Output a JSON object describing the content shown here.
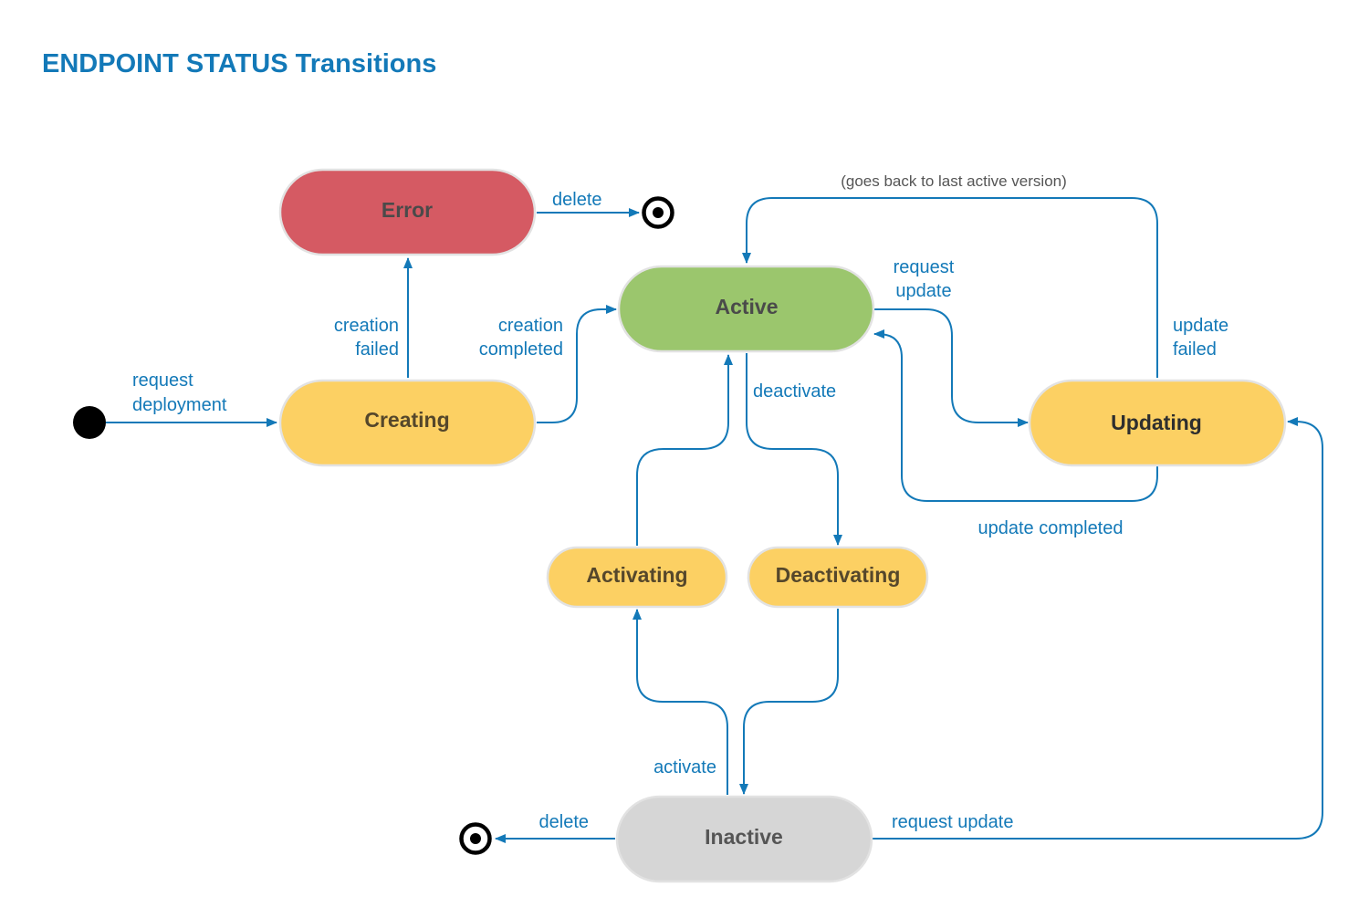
{
  "title": "ENDPOINT STATUS Transitions",
  "colors": {
    "accent": "#1379b8",
    "error_fill": "#d55a63",
    "active_fill": "#9bc66d",
    "transitional_fill": "#fcd063",
    "inactive_fill": "#d6d6d6",
    "node_text": "#4a4a4a",
    "pseudo_state": "#000000"
  },
  "states": {
    "error": {
      "label": "Error",
      "color": "#d55a63"
    },
    "active": {
      "label": "Active",
      "color": "#9bc66d"
    },
    "creating": {
      "label": "Creating",
      "color": "#fcd063"
    },
    "updating": {
      "label": "Updating",
      "color": "#fcd063"
    },
    "activating": {
      "label": "Activating",
      "color": "#fcd063"
    },
    "deactivating": {
      "label": "Deactivating",
      "color": "#fcd063"
    },
    "inactive": {
      "label": "Inactive",
      "color": "#d6d6d6"
    }
  },
  "pseudo_states": {
    "initial": {
      "type": "initial-node"
    },
    "final_error": {
      "type": "final-node"
    },
    "final_inactive": {
      "type": "final-node"
    }
  },
  "transitions": {
    "request_deployment": {
      "from": "initial",
      "to": "creating",
      "lines": [
        "request",
        "deployment"
      ]
    },
    "creation_failed": {
      "from": "creating",
      "to": "error",
      "lines": [
        "creation",
        "failed"
      ]
    },
    "creation_completed": {
      "from": "creating",
      "to": "active",
      "lines": [
        "creation",
        "completed"
      ]
    },
    "error_delete": {
      "from": "error",
      "to": "final_error",
      "lines": [
        "delete"
      ]
    },
    "request_update_active": {
      "from": "active",
      "to": "updating",
      "lines": [
        "request",
        "update"
      ]
    },
    "update_failed": {
      "from": "updating",
      "to": "active",
      "lines": [
        "update",
        "failed"
      ],
      "note": "(goes back to last active version)"
    },
    "update_completed": {
      "from": "updating",
      "to": "active",
      "lines": [
        "update completed"
      ]
    },
    "deactivate": {
      "from": "active",
      "to": "deactivating",
      "lines": [
        "deactivate"
      ]
    },
    "activating_done": {
      "from": "activating",
      "to": "active",
      "lines": []
    },
    "deactivating_done": {
      "from": "deactivating",
      "to": "inactive",
      "lines": []
    },
    "activate": {
      "from": "inactive",
      "to": "activating",
      "lines": [
        "activate"
      ]
    },
    "inactive_delete": {
      "from": "inactive",
      "to": "final_inactive",
      "lines": [
        "delete"
      ]
    },
    "request_update_inactive": {
      "from": "inactive",
      "to": "updating",
      "lines": [
        "request update"
      ]
    }
  }
}
